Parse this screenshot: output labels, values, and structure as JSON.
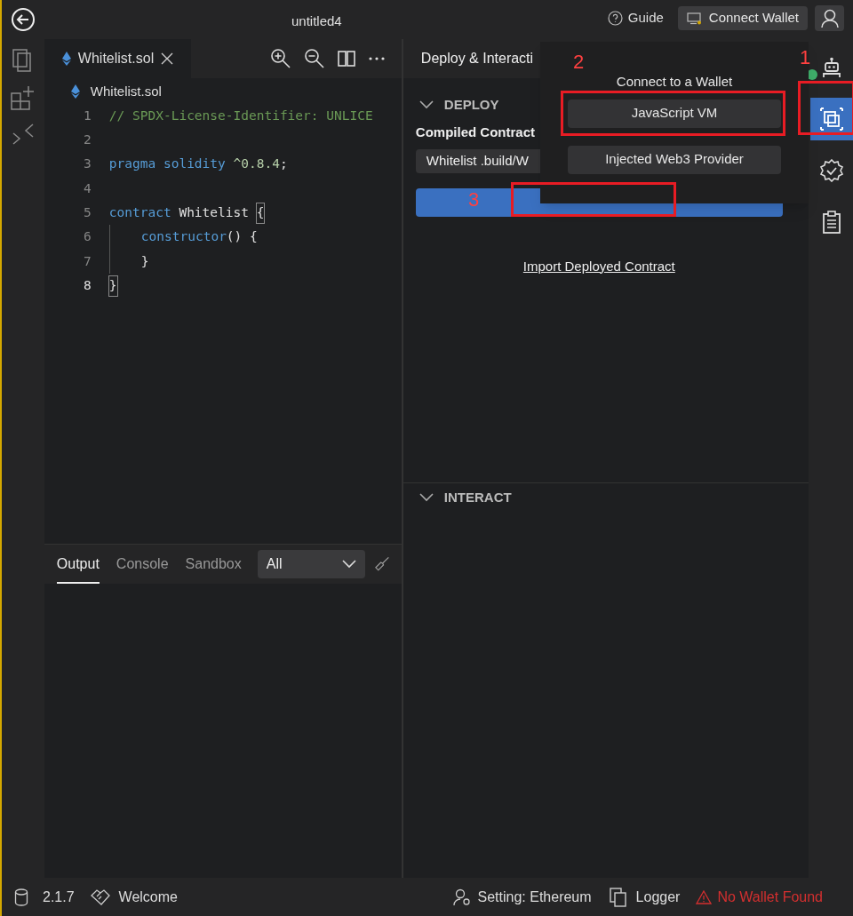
{
  "title_bar": {
    "title": "untitled4",
    "guide": "Guide",
    "connect_wallet": "Connect Wallet"
  },
  "editor": {
    "tabs": [
      {
        "label": "Whitelist.sol",
        "selected": true
      }
    ],
    "breadcrumb": "Whitelist.sol",
    "lines": [
      {
        "number": "1",
        "active": false,
        "tokens": [
          {
            "text": "// SPDX-License-Identifier: UNLICE",
            "kind": "comment"
          }
        ]
      },
      {
        "number": "2",
        "active": false
      },
      {
        "number": "3",
        "active": false,
        "tokens": [
          {
            "text": "pragma solidity",
            "kind": "keyword"
          },
          {
            "text": " ^0.8.4",
            "kind": "number"
          },
          {
            "text": ";",
            "kind": "plain"
          }
        ]
      },
      {
        "number": "4",
        "active": false
      },
      {
        "number": "5",
        "active": false,
        "tokens": [
          {
            "text": "contract",
            "kind": "keyword"
          },
          {
            "text": " Whitelist ",
            "kind": "plain"
          },
          {
            "text": "{",
            "kind": "bracket"
          }
        ],
        "children": [
          {
            "number": "6",
            "active": false,
            "tokens": [
              {
                "text": "constructor",
                "kind": "keyword"
              },
              {
                "text": "() {",
                "kind": "plain"
              }
            ]
          },
          {
            "number": "7",
            "active": false,
            "tokens": [
              {
                "text": "}",
                "kind": "plain"
              }
            ]
          }
        ]
      },
      {
        "number": "8",
        "active": true,
        "tokens": [
          {
            "text": "}",
            "kind": "bracket"
          }
        ]
      }
    ]
  },
  "output": {
    "tabs": [
      {
        "label": "Output",
        "selected": true
      },
      {
        "label": "Console",
        "selected": false
      },
      {
        "label": "Sandbox",
        "selected": false
      }
    ],
    "filter": "All"
  },
  "deploy_panel": {
    "title": "Deploy & Interacti",
    "deploy_section": {
      "label": "DEPLOY",
      "expanded": true
    },
    "compiled_label": "Compiled Contract",
    "contract_select": "Whitelist .build/W",
    "import_link": "Import Deployed Contract",
    "interact_section": {
      "label": "INTERACT",
      "expanded": true
    }
  },
  "wallet_popup": {
    "title": "Connect to a Wallet",
    "options": [
      "JavaScript VM",
      "Injected Web3 Provider"
    ]
  },
  "right_bar": [
    {
      "kind": "robot",
      "selected": false,
      "badge": true
    },
    {
      "kind": "deploy",
      "selected": true,
      "badge": false
    },
    {
      "kind": "verify",
      "selected": false,
      "badge": false
    },
    {
      "kind": "clipboard",
      "selected": false,
      "badge": false
    }
  ],
  "annotations": [
    {
      "label": "1"
    },
    {
      "label": "2"
    },
    {
      "label": "3"
    }
  ],
  "status_bar": {
    "version": "2.1.7",
    "welcome": "Welcome",
    "setting": "Setting: Ethereum",
    "logger": "Logger",
    "wallet_status": "No Wallet Found"
  }
}
